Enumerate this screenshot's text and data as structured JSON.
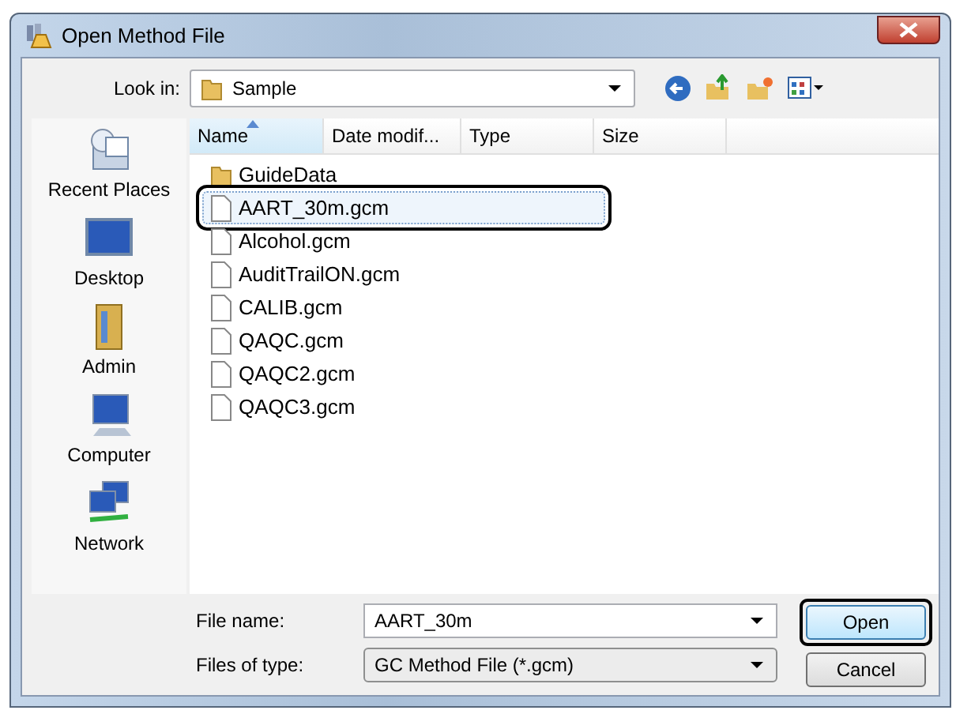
{
  "window": {
    "title": "Open Method File"
  },
  "look_in": {
    "label": "Look in:",
    "value": "Sample"
  },
  "places": [
    {
      "label": "Recent Places",
      "kind": "recent"
    },
    {
      "label": "Desktop",
      "kind": "desktop"
    },
    {
      "label": "Admin",
      "kind": "user"
    },
    {
      "label": "Computer",
      "kind": "computer"
    },
    {
      "label": "Network",
      "kind": "network"
    }
  ],
  "columns": [
    {
      "label": "Name",
      "sorted": true
    },
    {
      "label": "Date modif...",
      "sorted": false
    },
    {
      "label": "Type",
      "sorted": false
    },
    {
      "label": "Size",
      "sorted": false
    }
  ],
  "files": [
    {
      "name": "GuideData",
      "kind": "folder",
      "selected": false,
      "highlighted": false
    },
    {
      "name": "AART_30m.gcm",
      "kind": "file",
      "selected": true,
      "highlighted": true
    },
    {
      "name": "Alcohol.gcm",
      "kind": "file",
      "selected": false,
      "highlighted": false
    },
    {
      "name": "AuditTrailON.gcm",
      "kind": "file",
      "selected": false,
      "highlighted": false
    },
    {
      "name": "CALIB.gcm",
      "kind": "file",
      "selected": false,
      "highlighted": false
    },
    {
      "name": "QAQC.gcm",
      "kind": "file",
      "selected": false,
      "highlighted": false
    },
    {
      "name": "QAQC2.gcm",
      "kind": "file",
      "selected": false,
      "highlighted": false
    },
    {
      "name": "QAQC3.gcm",
      "kind": "file",
      "selected": false,
      "highlighted": false
    }
  ],
  "file_name": {
    "label": "File name:",
    "value": "AART_30m"
  },
  "file_type": {
    "label": "Files of type:",
    "value": "GC Method File (*.gcm)"
  },
  "buttons": [
    {
      "label": "Open",
      "highlighted": true
    },
    {
      "label": "Cancel",
      "highlighted": false
    }
  ]
}
